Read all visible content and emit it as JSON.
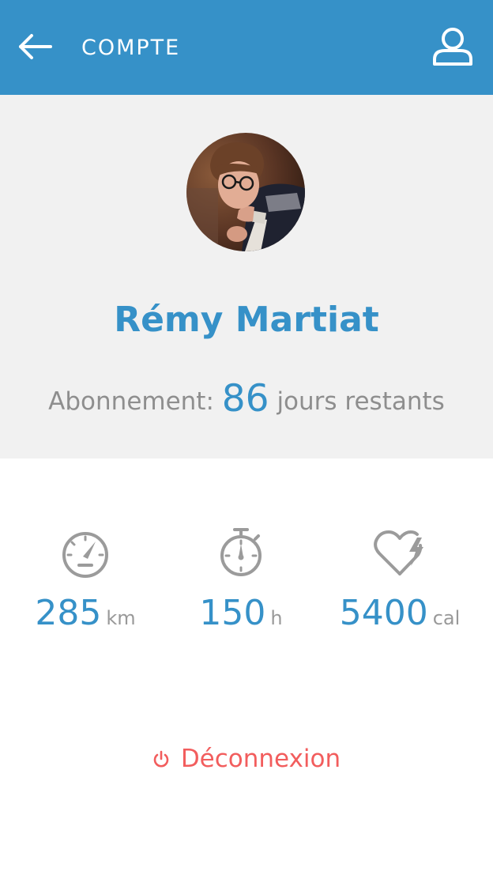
{
  "header": {
    "title": "COMPTE",
    "back_icon": "arrow-left-icon",
    "user_icon": "user-icon",
    "background_color": "#3691c8"
  },
  "profile": {
    "avatar": "avatar-photo",
    "name": "Rémy Martiat",
    "subscription_label": "Abonnement:",
    "subscription_days": "86",
    "subscription_suffix": "jours restants"
  },
  "stats": [
    {
      "icon": "speedometer-icon",
      "value": "285",
      "unit": "km"
    },
    {
      "icon": "stopwatch-icon",
      "value": "150",
      "unit": "h"
    },
    {
      "icon": "heart-energy-icon",
      "value": "5400",
      "unit": "cal"
    }
  ],
  "logout": {
    "icon": "power-icon",
    "label": "Déconnexion",
    "color": "#f25d5d"
  }
}
